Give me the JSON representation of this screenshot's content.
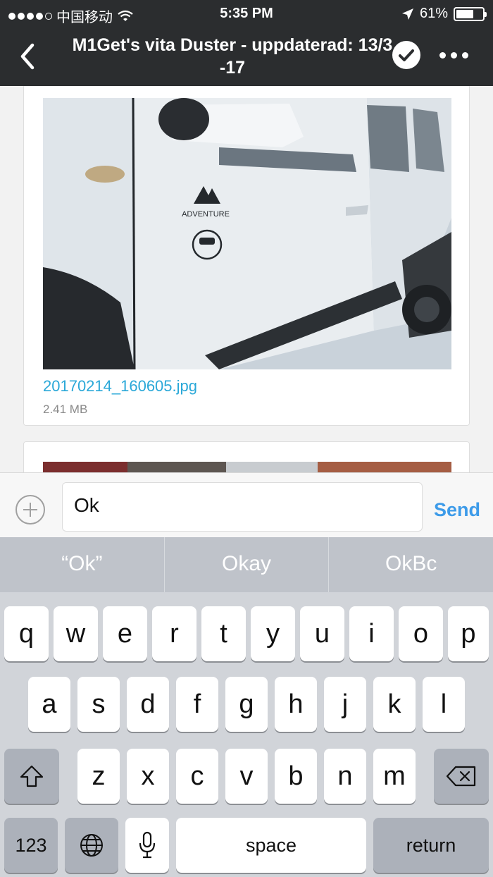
{
  "status": {
    "carrier": "中国移动",
    "time": "5:35 PM",
    "battery_percent": "61%",
    "battery_level": 0.61
  },
  "nav": {
    "title": "M1Get's vita Duster - uppdaterad: 13/3 -17"
  },
  "attachment": {
    "filename": "20170214_160605.jpg",
    "size": "2.41 MB"
  },
  "compose": {
    "value": "Ok",
    "send_label": "Send"
  },
  "keyboard": {
    "suggestions": [
      "“Ok”",
      "Okay",
      "OkBc"
    ],
    "row1": [
      "q",
      "w",
      "e",
      "r",
      "t",
      "y",
      "u",
      "i",
      "o",
      "p"
    ],
    "row2": [
      "a",
      "s",
      "d",
      "f",
      "g",
      "h",
      "j",
      "k",
      "l"
    ],
    "row3": [
      "z",
      "x",
      "c",
      "v",
      "b",
      "n",
      "m"
    ],
    "numbers_label": "123",
    "space_label": "space",
    "return_label": "return"
  },
  "icons": {
    "back": "chevron-left-icon",
    "check": "checkmark-circle-icon",
    "more": "ellipsis-icon",
    "add": "plus-circle-icon",
    "shift": "shift-icon",
    "delete": "backspace-icon",
    "globe": "globe-icon",
    "mic": "microphone-icon"
  }
}
